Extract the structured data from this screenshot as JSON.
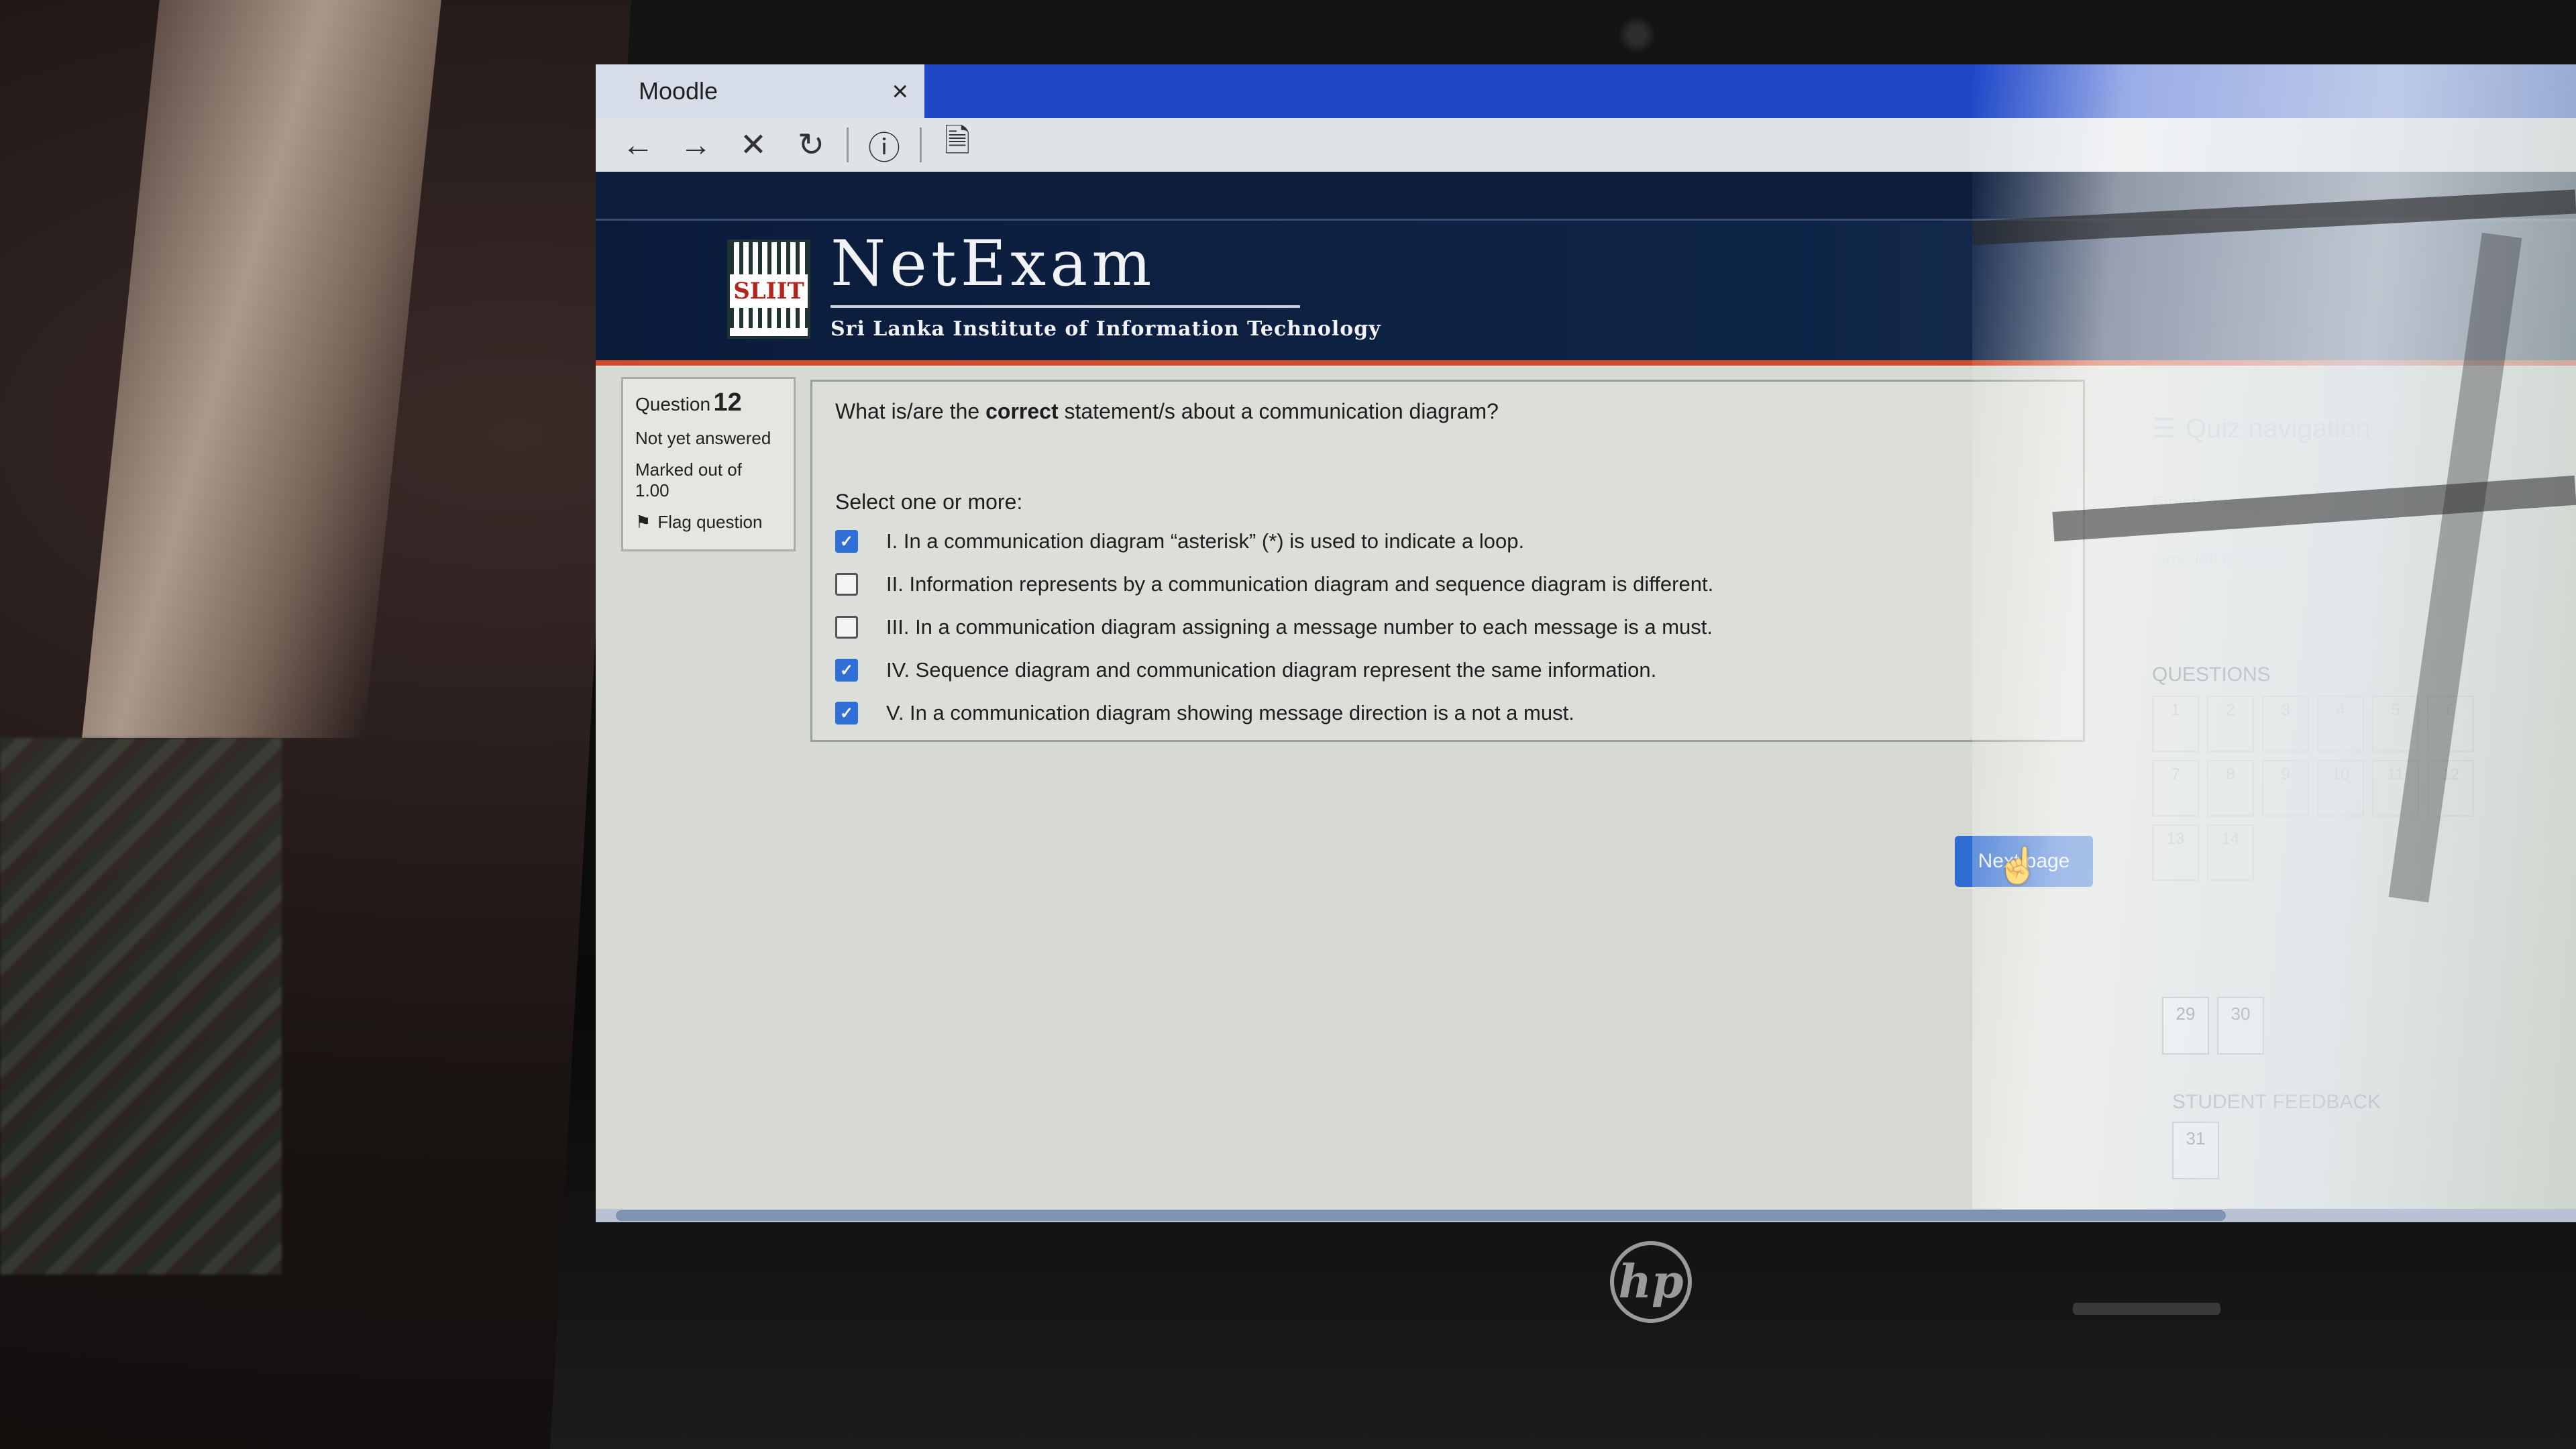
{
  "browser": {
    "tab_title": "Moodle",
    "tab_close": "×",
    "toolbar": {
      "back": "←",
      "forward": "→",
      "stop": "✕",
      "reload": "↻",
      "info": "ⓘ",
      "page": "🗎"
    }
  },
  "header": {
    "logo_text": "SLIIT",
    "brand_name": "NetExam",
    "brand_subtitle": "Sri Lanka Institute of Information Technology"
  },
  "question_info": {
    "label": "Question",
    "number": "12",
    "status": "Not yet answered",
    "marked_out_of": "Marked out of",
    "marks": "1.00",
    "flag_label": "Flag question"
  },
  "question": {
    "text_before": "What is/are the ",
    "text_bold": "correct",
    "text_after": " statement/s about a communication diagram?",
    "prompt": "Select one or more:",
    "options": [
      {
        "label": "I. In a communication diagram “asterisk” (*) is used to indicate a loop.",
        "checked": true
      },
      {
        "label": "II. Information represents  by a communication diagram and sequence diagram is different.",
        "checked": false
      },
      {
        "label": "III. In a communication diagram assigning a message number to each message is a must.",
        "checked": false
      },
      {
        "label": "IV. Sequence diagram and communication diagram represent the same information.",
        "checked": true
      },
      {
        "label": "V. In a communication diagram showing message direction is a not a must.",
        "checked": true
      }
    ]
  },
  "next_button": "Next page",
  "quiz_nav": {
    "title": "Quiz navigation",
    "finish_link": "Finish attempt ...",
    "time_left": "Time left 0:33:06",
    "questions_label": "QUESTIONS",
    "cells": [
      "1",
      "2",
      "3",
      "4",
      "5",
      "6",
      "7",
      "8",
      "9",
      "10",
      "11",
      "12",
      "13",
      "14"
    ],
    "visible_cells": [
      "29",
      "30"
    ],
    "feedback_label": "STUDENT FEEDBACK",
    "feedback_cell": "31"
  },
  "device": {
    "brand": "hp"
  }
}
